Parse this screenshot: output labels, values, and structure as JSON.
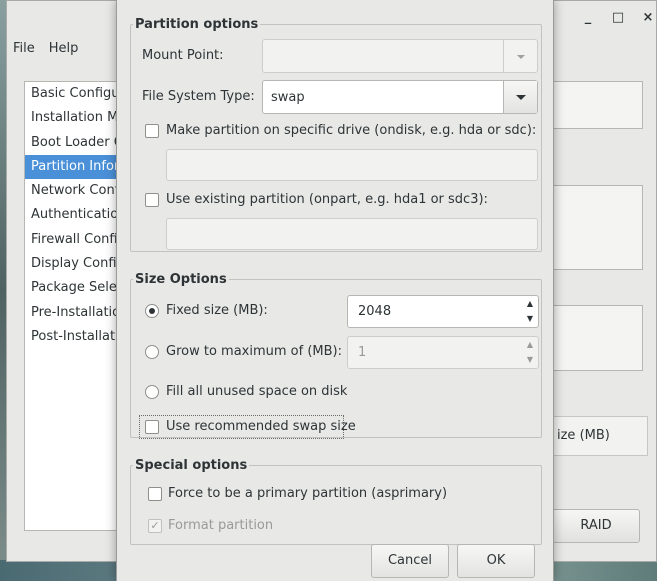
{
  "window": {
    "menu": [
      "File",
      "Help"
    ],
    "controls": {
      "minimize": "_",
      "maximize": "□",
      "close": "×"
    },
    "sidebar_items": [
      {
        "label": "Basic Configur",
        "selected": false
      },
      {
        "label": "Installation Me",
        "selected": false
      },
      {
        "label": "Boot Loader O",
        "selected": false
      },
      {
        "label": "Partition Inform",
        "selected": true
      },
      {
        "label": "Network Confi",
        "selected": false
      },
      {
        "label": "Authentication",
        "selected": false
      },
      {
        "label": "Firewall Config",
        "selected": false
      },
      {
        "label": "Display Config",
        "selected": false
      },
      {
        "label": "Package Selec",
        "selected": false
      },
      {
        "label": "Pre-Installation",
        "selected": false
      },
      {
        "label": "Post-Installatio",
        "selected": false
      }
    ],
    "partition_table_header_size": "ize (MB)",
    "raid_button": "RAID"
  },
  "dialog": {
    "partition_options": {
      "title": "Partition options",
      "mount_point_label": "Mount Point:",
      "mount_point_value": "",
      "fs_type_label": "File System Type:",
      "fs_type_value": "swap",
      "ondisk_label": "Make partition on specific drive (ondisk, e.g. hda or sdc):",
      "ondisk_checked": false,
      "ondisk_value": "",
      "onpart_label": "Use existing partition (onpart, e.g. hda1 or sdc3):",
      "onpart_checked": false,
      "onpart_value": ""
    },
    "size_options": {
      "title": "Size Options",
      "fixed_label": "Fixed size (MB):",
      "fixed_value": "2048",
      "fixed_selected": true,
      "grow_label": "Grow to maximum of (MB):",
      "grow_value": "1",
      "grow_selected": false,
      "fill_label": "Fill all unused space on disk",
      "fill_selected": false,
      "recommended_swap_label": "Use recommended swap size",
      "recommended_swap_checked": false
    },
    "special_options": {
      "title": "Special options",
      "primary_label": "Force to be a primary partition (asprimary)",
      "primary_checked": false,
      "format_label": "Format partition",
      "format_checked": true
    },
    "buttons": {
      "cancel": "Cancel",
      "ok": "OK"
    }
  },
  "colors": {
    "selection": "#4a90d9",
    "dialog_bg": "#e8e8e7",
    "disabled_text": "#9a9b98"
  }
}
